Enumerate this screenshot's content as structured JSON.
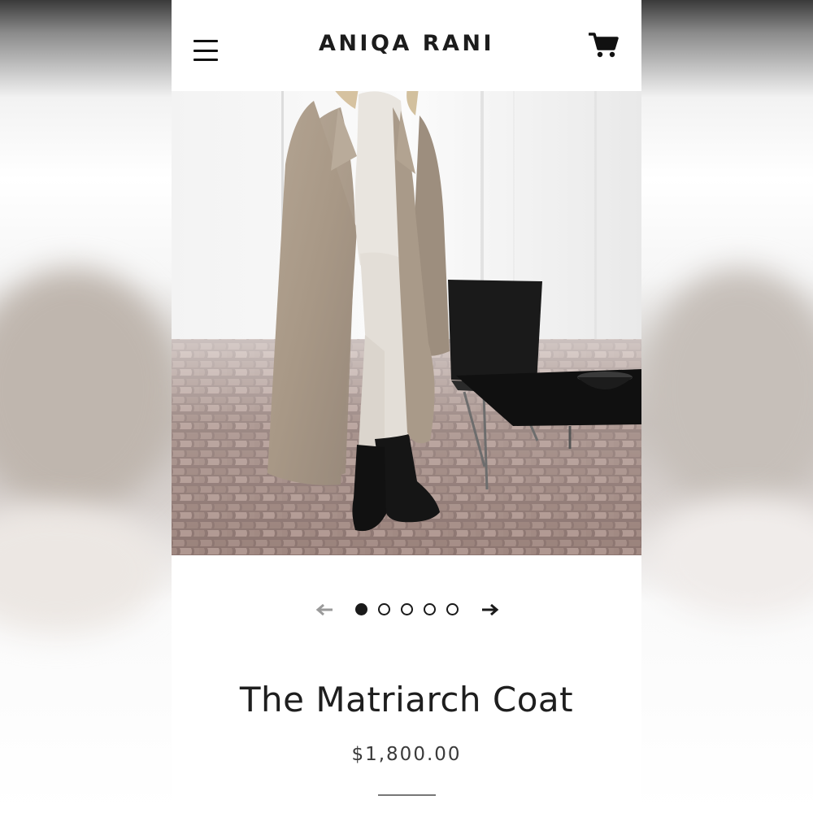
{
  "header": {
    "store_title": "ANIQA RANI",
    "menu_icon": "hamburger-menu-icon",
    "cart_icon": "shopping-cart-icon"
  },
  "product": {
    "title": "The Matriarch Coat",
    "price": "$1,800.00",
    "image_alt": "Model wearing a long beige faux fur coat with white turtleneck, cream trousers and black boots beside a black chair and low table"
  },
  "gallery": {
    "prev_icon": "arrow-left-icon",
    "next_icon": "arrow-right-icon",
    "slide_count": 5,
    "active_slide": 1
  },
  "colors": {
    "text": "#1e1e1e",
    "accent": "#1a1a1a",
    "arrow_disabled": "#9a9a9a"
  }
}
